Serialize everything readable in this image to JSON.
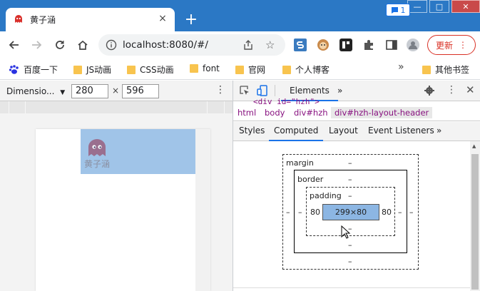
{
  "tab": {
    "title": "黄子涵",
    "close": "×",
    "new_tab": "+"
  },
  "window": {
    "minimize": "—",
    "maximize": "□",
    "close": "✕"
  },
  "address": {
    "url": "localhost:8080/#/"
  },
  "update_button": {
    "label": "更新",
    "menu": "⋮"
  },
  "bookmarks": {
    "items": [
      {
        "label": "百度一下"
      },
      {
        "label": "JS动画"
      },
      {
        "label": "CSS动画"
      },
      {
        "label": "font"
      },
      {
        "label": "官网"
      },
      {
        "label": "个人博客"
      }
    ],
    "more": "»",
    "other": "其他书签"
  },
  "device_toolbar": {
    "preset": "Dimensio...",
    "width": "280",
    "height": "596",
    "times": "×",
    "menu": "⋮"
  },
  "page": {
    "logo_text": "黄子涵"
  },
  "devtools": {
    "main_tab": "Elements",
    "more_tabs": "»",
    "issues_count": "1",
    "dom_peek": "<div id=\"hzh\">",
    "breadcrumbs": [
      "html",
      "body",
      "div#hzh",
      "div#hzh-layout-header"
    ],
    "subtabs": [
      "Styles",
      "Computed",
      "Layout",
      "Event Listeners"
    ],
    "subtabs_more": "»",
    "box_model": {
      "margin_label": "margin",
      "border_label": "border",
      "padding_label": "padding",
      "dash": "–",
      "padding_left": "80",
      "padding_right": "80",
      "content": "299×80"
    }
  },
  "colors": {
    "titlebar": "#2b78c5",
    "header_highlight": "#a0c4e8",
    "content_box": "#8cb6e3",
    "accent": "#1a73e8",
    "update": "#d93025"
  }
}
